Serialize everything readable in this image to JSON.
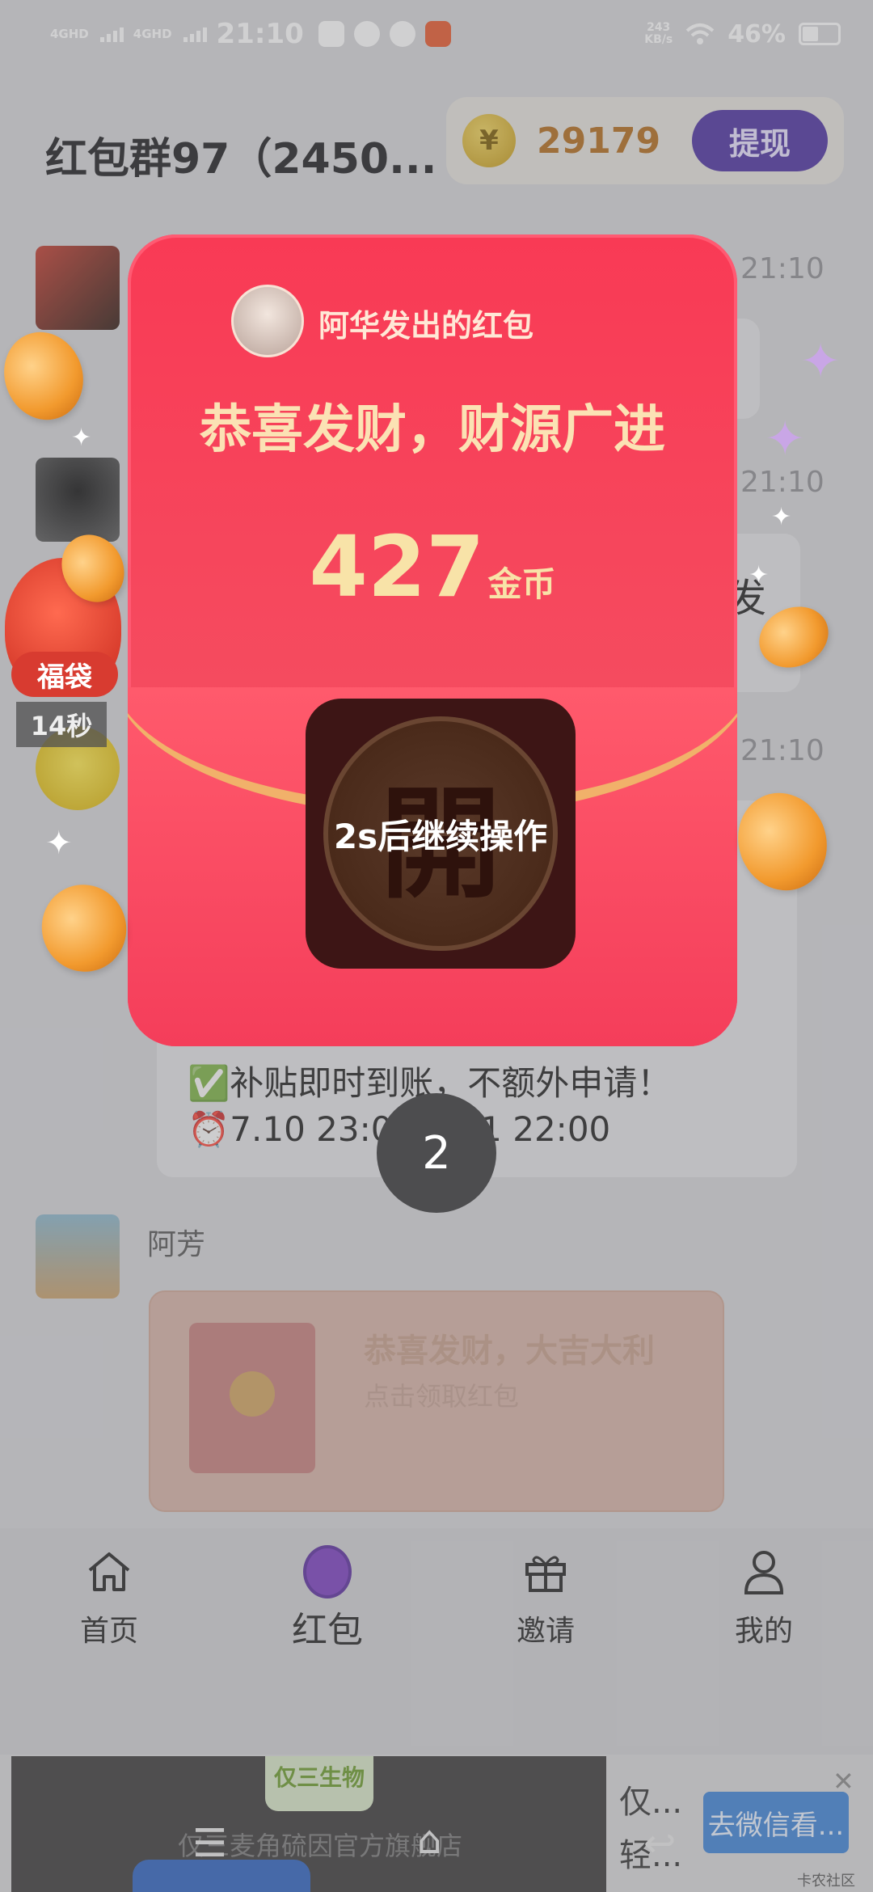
{
  "status_bar": {
    "network1": "4GHD",
    "network2": "4GHD",
    "time": "21:10",
    "speed_value": "243",
    "speed_unit": "KB/s",
    "battery": "46%"
  },
  "header": {
    "group_title": "红包群97（2450...",
    "coin_symbol": "¥",
    "coin_balance": "29179",
    "withdraw_label": "提现"
  },
  "chat": {
    "timestamps": [
      "21:10",
      "21:10",
      "21:10"
    ],
    "notice_lines": [
      "✅补贴即时到账，不额外申请！",
      "⏰7.10 23:00-8.31 22:00"
    ],
    "partial_text": "发",
    "sender_name": "阿芳",
    "faded_packet": {
      "title": "恭喜发财，大吉大利",
      "subtitle": "点击领取红包"
    }
  },
  "lucky_bag": {
    "label": "福袋",
    "timer": "14秒"
  },
  "red_packet": {
    "from_text": "阿华发出的红包",
    "blessing": "恭喜发财，财源广进",
    "amount": "427",
    "unit": "金币",
    "open_glyph": "開",
    "countdown_text": "2s后继续操作"
  },
  "countdown_bubble": "2",
  "bottom_nav": {
    "items": [
      {
        "label": "首页"
      },
      {
        "label": "红包"
      },
      {
        "label": "邀请"
      },
      {
        "label": "我的"
      }
    ]
  },
  "ad": {
    "badge": "仅三生物",
    "store": "仅三麦角硫因官方旗舰店",
    "right_line1": "仅...",
    "right_line2": "轻...",
    "cta": "去微信看...",
    "close": "✕",
    "watermark": "卡农社区"
  },
  "colors": {
    "packet_red": "#f93a55",
    "coin_text": "#b36a1a",
    "withdraw_bg": "#4a2fa0",
    "ad_cta": "#3d83d8"
  }
}
